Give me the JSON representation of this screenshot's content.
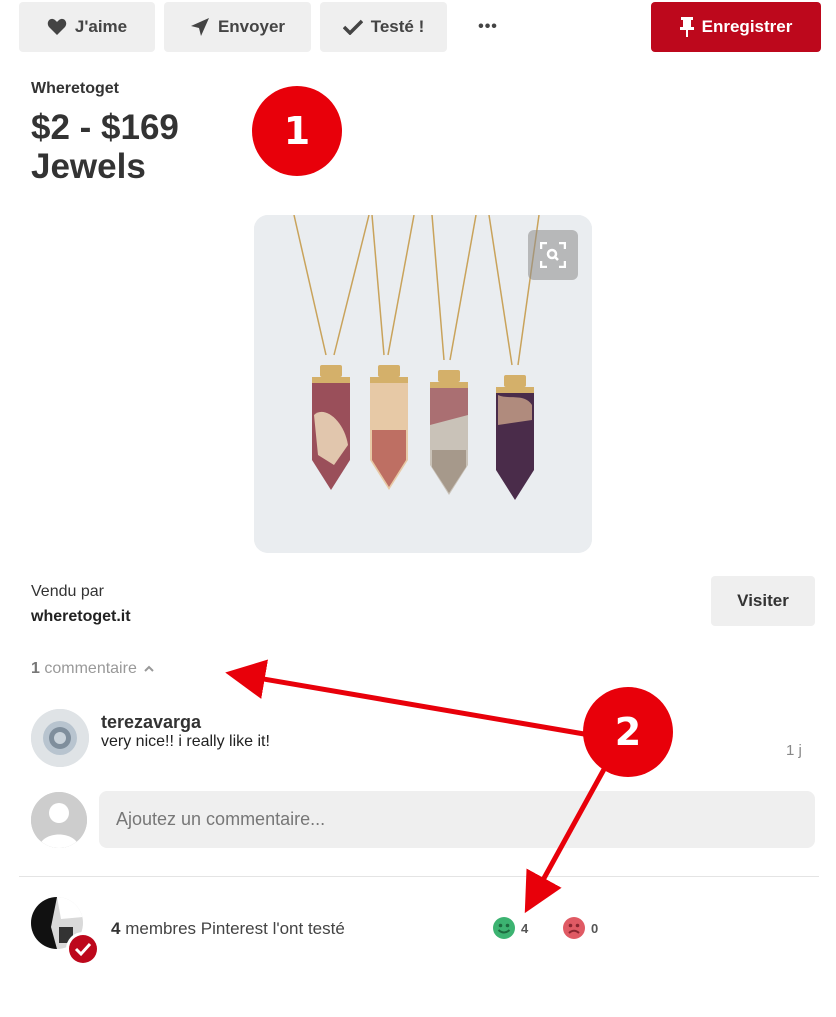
{
  "toolbar": {
    "like_label": "J'aime",
    "send_label": "Envoyer",
    "tried_label": "Testé !",
    "more_label": "•••",
    "save_label": "Enregistrer"
  },
  "pin": {
    "source": "Wheretoget",
    "title_line1": "$2 - $169",
    "title_line2": "Jewels"
  },
  "seller": {
    "label": "Vendu par",
    "site": "wheretoget.it",
    "visit_label": "Visiter"
  },
  "comments": {
    "count": "1",
    "count_label": "commentaire",
    "items": [
      {
        "user": "terezavarga",
        "text": "very nice!! i really like it!",
        "time": "1 j"
      }
    ],
    "input_placeholder": "Ajoutez un commentaire..."
  },
  "tried": {
    "count": "4",
    "text": "membres Pinterest l'ont testé",
    "positive_count": "4",
    "negative_count": "0"
  },
  "annotations": {
    "badge_1": "1",
    "badge_2": "2"
  },
  "colors": {
    "brand_red": "#bd081c",
    "annotation_red": "#e8000a",
    "positive_green": "#3cb371",
    "negative_red": "#e05a64"
  }
}
